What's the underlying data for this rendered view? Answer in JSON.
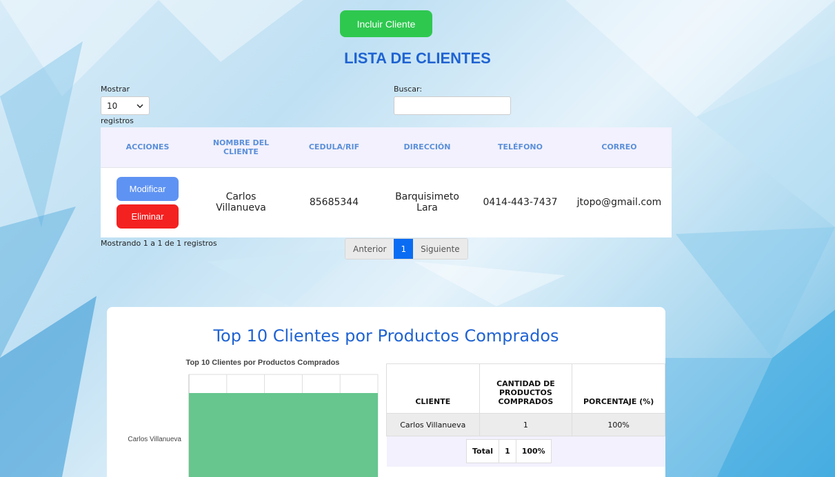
{
  "header": {
    "add_button_label": "Incluir Cliente",
    "title": "LISTA DE CLIENTES"
  },
  "controls": {
    "show_label": "Mostrar",
    "show_value": "10",
    "records_label": "registros",
    "search_label": "Buscar:",
    "search_value": ""
  },
  "table": {
    "headers": [
      "ACCIONES",
      "NOMBRE DEL CLIENTE",
      "CEDULA/RIF",
      "DIRECCIÓN",
      "TELÉFONO",
      "CORREO"
    ],
    "rows": [
      {
        "edit_label": "Modificar",
        "delete_label": "Eliminar",
        "name": "Carlos Villanueva",
        "cedula": "85685344",
        "direccion": "Barquisimeto Lara",
        "telefono": "0414-443-7437",
        "correo": "jtopo@gmail.com"
      }
    ]
  },
  "pagination": {
    "info": "Mostrando 1 a 1 de 1 registros",
    "prev": "Anterior",
    "current": "1",
    "next": "Siguiente"
  },
  "top_section": {
    "title": "Top 10 Clientes por Productos Comprados",
    "stats_headers": [
      "CLIENTE",
      "CANTIDAD DE PRODUCTOS COMPRADOS",
      "PORCENTAJE (%)"
    ],
    "stats_rows": [
      {
        "cliente": "Carlos Villanueva",
        "cantidad": "1",
        "porcentaje": "100%"
      }
    ],
    "totals": {
      "label": "Total",
      "cantidad": "1",
      "porcentaje": "100%"
    }
  },
  "chart_data": {
    "type": "bar",
    "orientation": "horizontal",
    "title": "Top 10 Clientes por Productos Comprados",
    "categories": [
      "Carlos Villanueva"
    ],
    "values": [
      1
    ],
    "colors": [
      "#66c68e"
    ],
    "grid": true
  },
  "colors": {
    "primary": "#1f63d2",
    "add_button": "#2ec84f",
    "edit_button": "#5f93f3",
    "delete_button": "#f42121",
    "page_active": "#0a6cf2"
  }
}
